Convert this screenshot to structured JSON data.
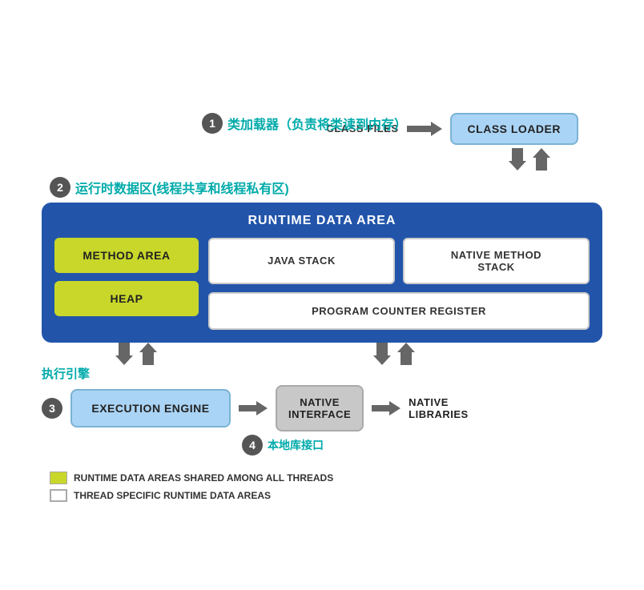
{
  "annotations": {
    "num1": "1",
    "num2": "2",
    "num3": "3",
    "num4": "4",
    "label1": "类加载器（负责将类读到内存）",
    "label2": "运行时数据区(线程共享和线程私有区)",
    "label3": "执行引擎",
    "label4": "本地库接口"
  },
  "classLoader": {
    "classFilesLabel": "CLASS FILES",
    "boxLabel": "CLASS LOADER"
  },
  "runtimeArea": {
    "title": "RUNTIME DATA AREA",
    "methodArea": "METHOD AREA",
    "heap": "HEAP",
    "javaStack": "JAVA STACK",
    "nativeMethodStack": "NATIVE METHOD\nSTACK",
    "programCounter": "PROGRAM COUNTER REGISTER"
  },
  "executionSection": {
    "engineLabel": "EXECUTION ENGINE",
    "nativeInterfaceLabel": "NATIVE\nINTERFACE",
    "nativeLibrariesLabel": "NATIVE\nLIBRARIES"
  },
  "legend": {
    "item1": "RUNTIME DATA AREAS SHARED AMONG ALL THREADS",
    "item2": "THREAD SPECIFIC RUNTIME DATA AREAS"
  }
}
